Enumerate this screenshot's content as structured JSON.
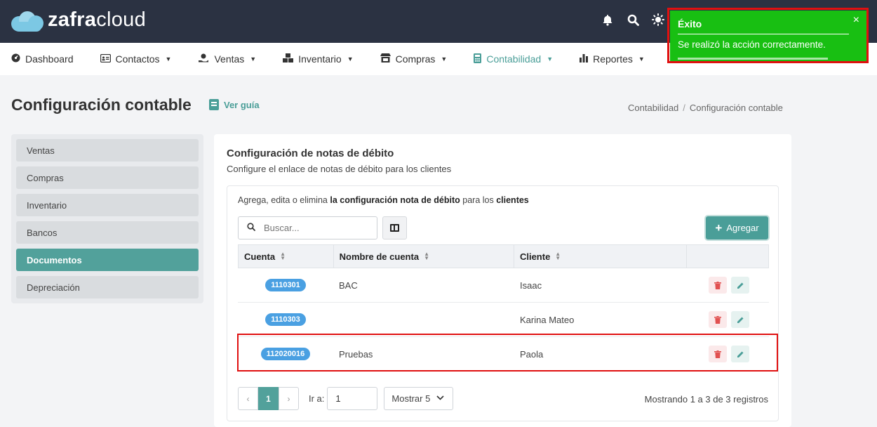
{
  "brand": {
    "name_bold": "zafra",
    "name_light": "cloud"
  },
  "colors": {
    "topbar": "#2b3242",
    "accent": "#4a9e98",
    "badge": "#4aa0e2",
    "toast": "#18bf12",
    "highlight": "#e01010"
  },
  "topbar": {
    "icons": [
      "bell-icon",
      "search-icon",
      "sun-icon"
    ]
  },
  "nav": {
    "items": [
      {
        "label": "Dashboard"
      },
      {
        "label": "Contactos"
      },
      {
        "label": "Ventas"
      },
      {
        "label": "Inventario"
      },
      {
        "label": "Compras"
      },
      {
        "label": "Contabilidad"
      },
      {
        "label": "Reportes"
      }
    ]
  },
  "header": {
    "title": "Configuración contable",
    "guide_label": "Ver guía",
    "breadcrumb": [
      "Contabilidad",
      "Configuración contable"
    ]
  },
  "side_menu": {
    "items": [
      {
        "label": "Ventas"
      },
      {
        "label": "Compras"
      },
      {
        "label": "Inventario"
      },
      {
        "label": "Bancos"
      },
      {
        "label": "Documentos"
      },
      {
        "label": "Depreciación"
      }
    ],
    "active": "Documentos"
  },
  "card": {
    "title": "Configuración de notas de débito",
    "subtitle": "Configure el enlace de notas de débito para los clientes",
    "desc_pre": "Agrega, edita o elimina ",
    "desc_bold1": "la configuración nota de débito",
    "desc_mid": " para los ",
    "desc_bold2": "clientes",
    "search_placeholder": "Buscar...",
    "add_label": "Agregar"
  },
  "table": {
    "headers": [
      "Cuenta",
      "Nombre de cuenta",
      "Cliente"
    ],
    "rows": [
      {
        "cuenta": "1110301",
        "nombre": "BAC",
        "cliente": "Isaac"
      },
      {
        "cuenta": "1110303",
        "nombre": "",
        "cliente": "Karina Mateo"
      },
      {
        "cuenta": "112020016",
        "nombre": "Pruebas",
        "cliente": "Paola"
      }
    ]
  },
  "pagination": {
    "prev": "‹",
    "current": "1",
    "next": "›",
    "goto_label": "Ir a:",
    "goto_value": "1",
    "show_label": "Mostrar 5",
    "showing_text": "Mostrando 1 a 3 de 3 registros"
  },
  "toast": {
    "title": "Éxito",
    "message": "Se realizó la acción correctamente.",
    "close": "×"
  }
}
